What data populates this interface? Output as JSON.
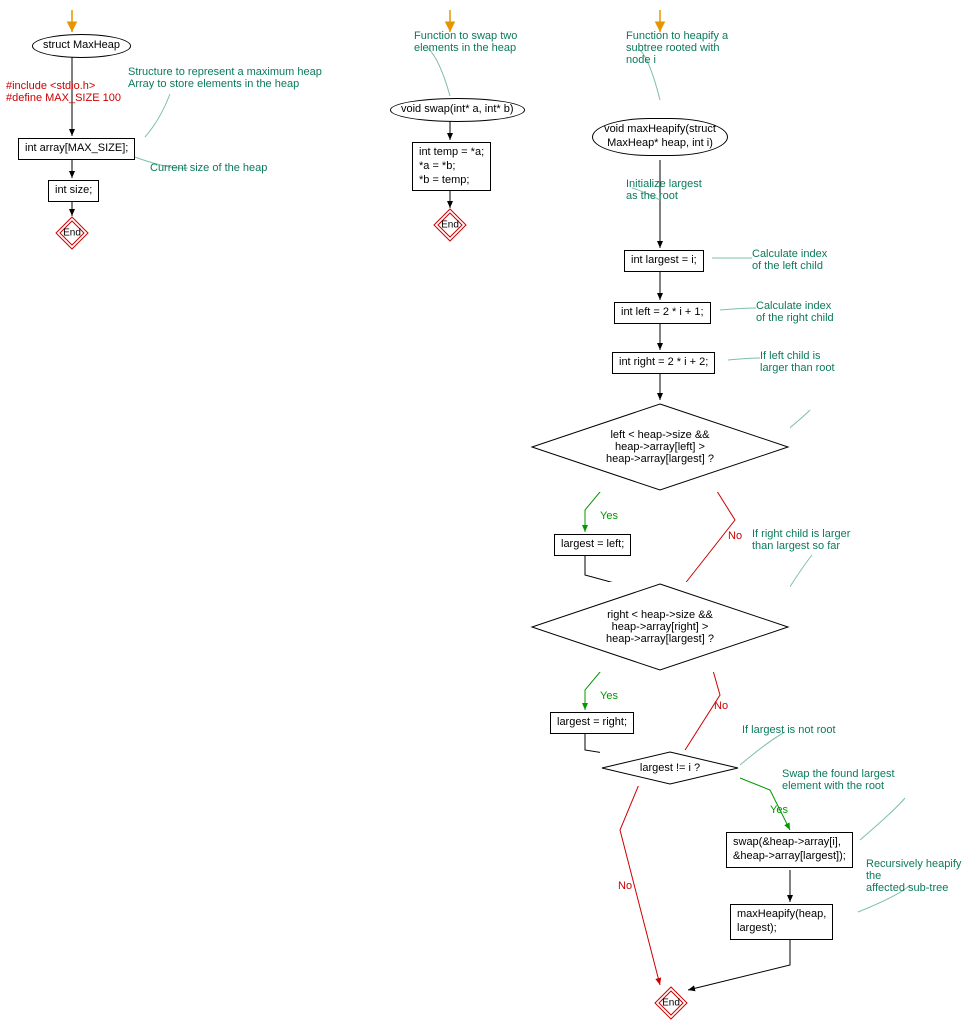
{
  "col1": {
    "title": "struct MaxHeap",
    "include": "#include <stdio.h>\n#define MAX_SIZE 100",
    "comment1": "Structure to represent a maximum heap\nArray to store elements in the heap",
    "box1": "int array[MAX_SIZE];",
    "comment2": "Current size of the heap",
    "box2": "int size;",
    "end": "End"
  },
  "col2": {
    "comment": "Function to swap two\nelements in the heap",
    "title": "void swap(int* a, int* b)",
    "box": "int temp = *a;\n*a = *b;\n*b = temp;",
    "end": "End"
  },
  "col3": {
    "comment_top": "Function to heapify a\nsubtree rooted with\nnode i",
    "title": "void maxHeapify(struct\nMaxHeap* heap, int i)",
    "comment_init": "Initialize largest\nas the root",
    "box_largest": "int largest = i;",
    "comment_left": "Calculate index\nof the left child",
    "box_left": "int left = 2 * i + 1;",
    "comment_right": "Calculate index\nof the right child",
    "box_right": "int right = 2 * i + 2;",
    "comment_cond1": "If left child is\nlarger than root",
    "cond1": "left < heap->size &&\nheap->array[left] >\nheap->array[largest] ?",
    "box_setleft": "largest = left;",
    "comment_cond2": "If right child is larger\nthan largest so far",
    "cond2": "right < heap->size &&\nheap->array[right] >\nheap->array[largest] ?",
    "box_setright": "largest = right;",
    "comment_cond3": "If largest is not root",
    "cond3": "largest != i ?",
    "comment_swap": "Swap the found largest\nelement with the root",
    "box_swap": "swap(&heap->array[i],\n&heap->array[largest]);",
    "comment_rec": "Recursively heapify the\naffected sub-tree",
    "box_rec": "maxHeapify(heap,\nlargest);",
    "end": "End",
    "yes": "Yes",
    "no": "No"
  }
}
